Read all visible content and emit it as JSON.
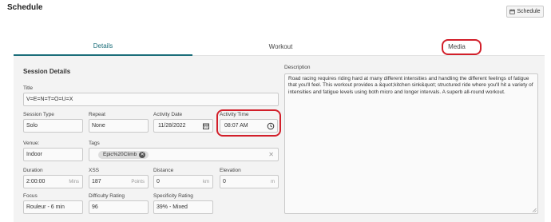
{
  "header": {
    "title": "Schedule",
    "schedule_button": "Schedule"
  },
  "tabs": [
    {
      "label": "Details",
      "active": true
    },
    {
      "label": "Workout",
      "active": false
    },
    {
      "label": "Media",
      "active": false
    }
  ],
  "session": {
    "section_title": "Session Details",
    "title_label": "Title",
    "title_value": "V=E=N=T=O=U=X",
    "session_type_label": "Session Type",
    "session_type_value": "Solo",
    "repeat_label": "Repeat",
    "repeat_value": "None",
    "activity_date_label": "Activity Date",
    "activity_date_value": "11/28/2022",
    "activity_time_label": "Activity Time",
    "activity_time_value": "08:07 AM",
    "venue_label": "Venue:",
    "venue_value": "Indoor",
    "tags_label": "Tags",
    "tags": [
      "Epic%20Climb"
    ],
    "duration_label": "Duration",
    "duration_value": "2:00:00",
    "duration_unit": "Mins",
    "xss_label": "XSS",
    "xss_value": "187",
    "xss_unit": "Points",
    "distance_label": "Distance",
    "distance_value": "0",
    "distance_unit": "km",
    "elevation_label": "Elevation",
    "elevation_value": "0",
    "elevation_unit": "m",
    "focus_label": "Focus",
    "focus_value": "Rouleur - 6 min",
    "difficulty_label": "Difficulty Rating",
    "difficulty_value": "96",
    "specificity_label": "Specificity Rating",
    "specificity_value": "39% - Mixed"
  },
  "description": {
    "label": "Description",
    "text": "Road racing requires riding hard at many different intensities and handling the different feelings of fatigue that you'll feel.  This workout provides a &quot;kitchen sink&quot; structured ride where you'll hit a variety of intensities and fatigue levels using both micro and longer intervals.  A superb all-round workout."
  },
  "colors": {
    "accent": "#1c6e7a",
    "highlight": "#d21f2a",
    "panel": "#f3f3f3"
  }
}
